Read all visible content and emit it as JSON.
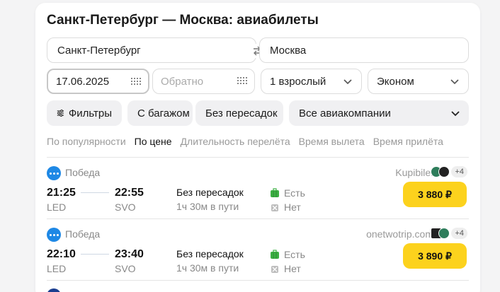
{
  "title": "Санкт-Петербург — Москва: авиабилеты",
  "search": {
    "from": "Санкт-Петербург",
    "to": "Москва",
    "date_there": "17.06.2025",
    "date_back_placeholder": "Обратно",
    "passengers": "1 взрослый",
    "cabin": "Эконом"
  },
  "filters": {
    "filters_label": "Фильтры",
    "baggage_label": "С багажом",
    "nonstop_label": "Без пересадок",
    "airlines_label": "Все авиакомпании"
  },
  "sort": {
    "popularity": "По популярности",
    "price": "По цене",
    "duration": "Длительность перелёта",
    "departure": "Время вылета",
    "arrival": "Время прилёта"
  },
  "results": [
    {
      "airline": "Победа",
      "agency": "Kupibilet",
      "agency_more": "+4",
      "dep_time": "21:25",
      "dep_code": "LED",
      "arr_time": "22:55",
      "arr_code": "SVO",
      "stops": "Без пересадок",
      "duration": "1ч 30м в пути",
      "baggage": "Есть",
      "no_baggage": "Нет",
      "price": "3 880 ₽"
    },
    {
      "airline": "Победа",
      "agency": "onetwotrip.com",
      "agency_more": "+4",
      "dep_time": "22:10",
      "dep_code": "LED",
      "arr_time": "23:40",
      "arr_code": "SVO",
      "stops": "Без пересадок",
      "duration": "1ч 30м в пути",
      "baggage": "Есть",
      "no_baggage": "Нет",
      "price": "3 890 ₽"
    }
  ],
  "colors": {
    "accent_price": "#fcd21d",
    "airline_logo": "#1e88e5",
    "baggage_yes": "#3cb043"
  }
}
